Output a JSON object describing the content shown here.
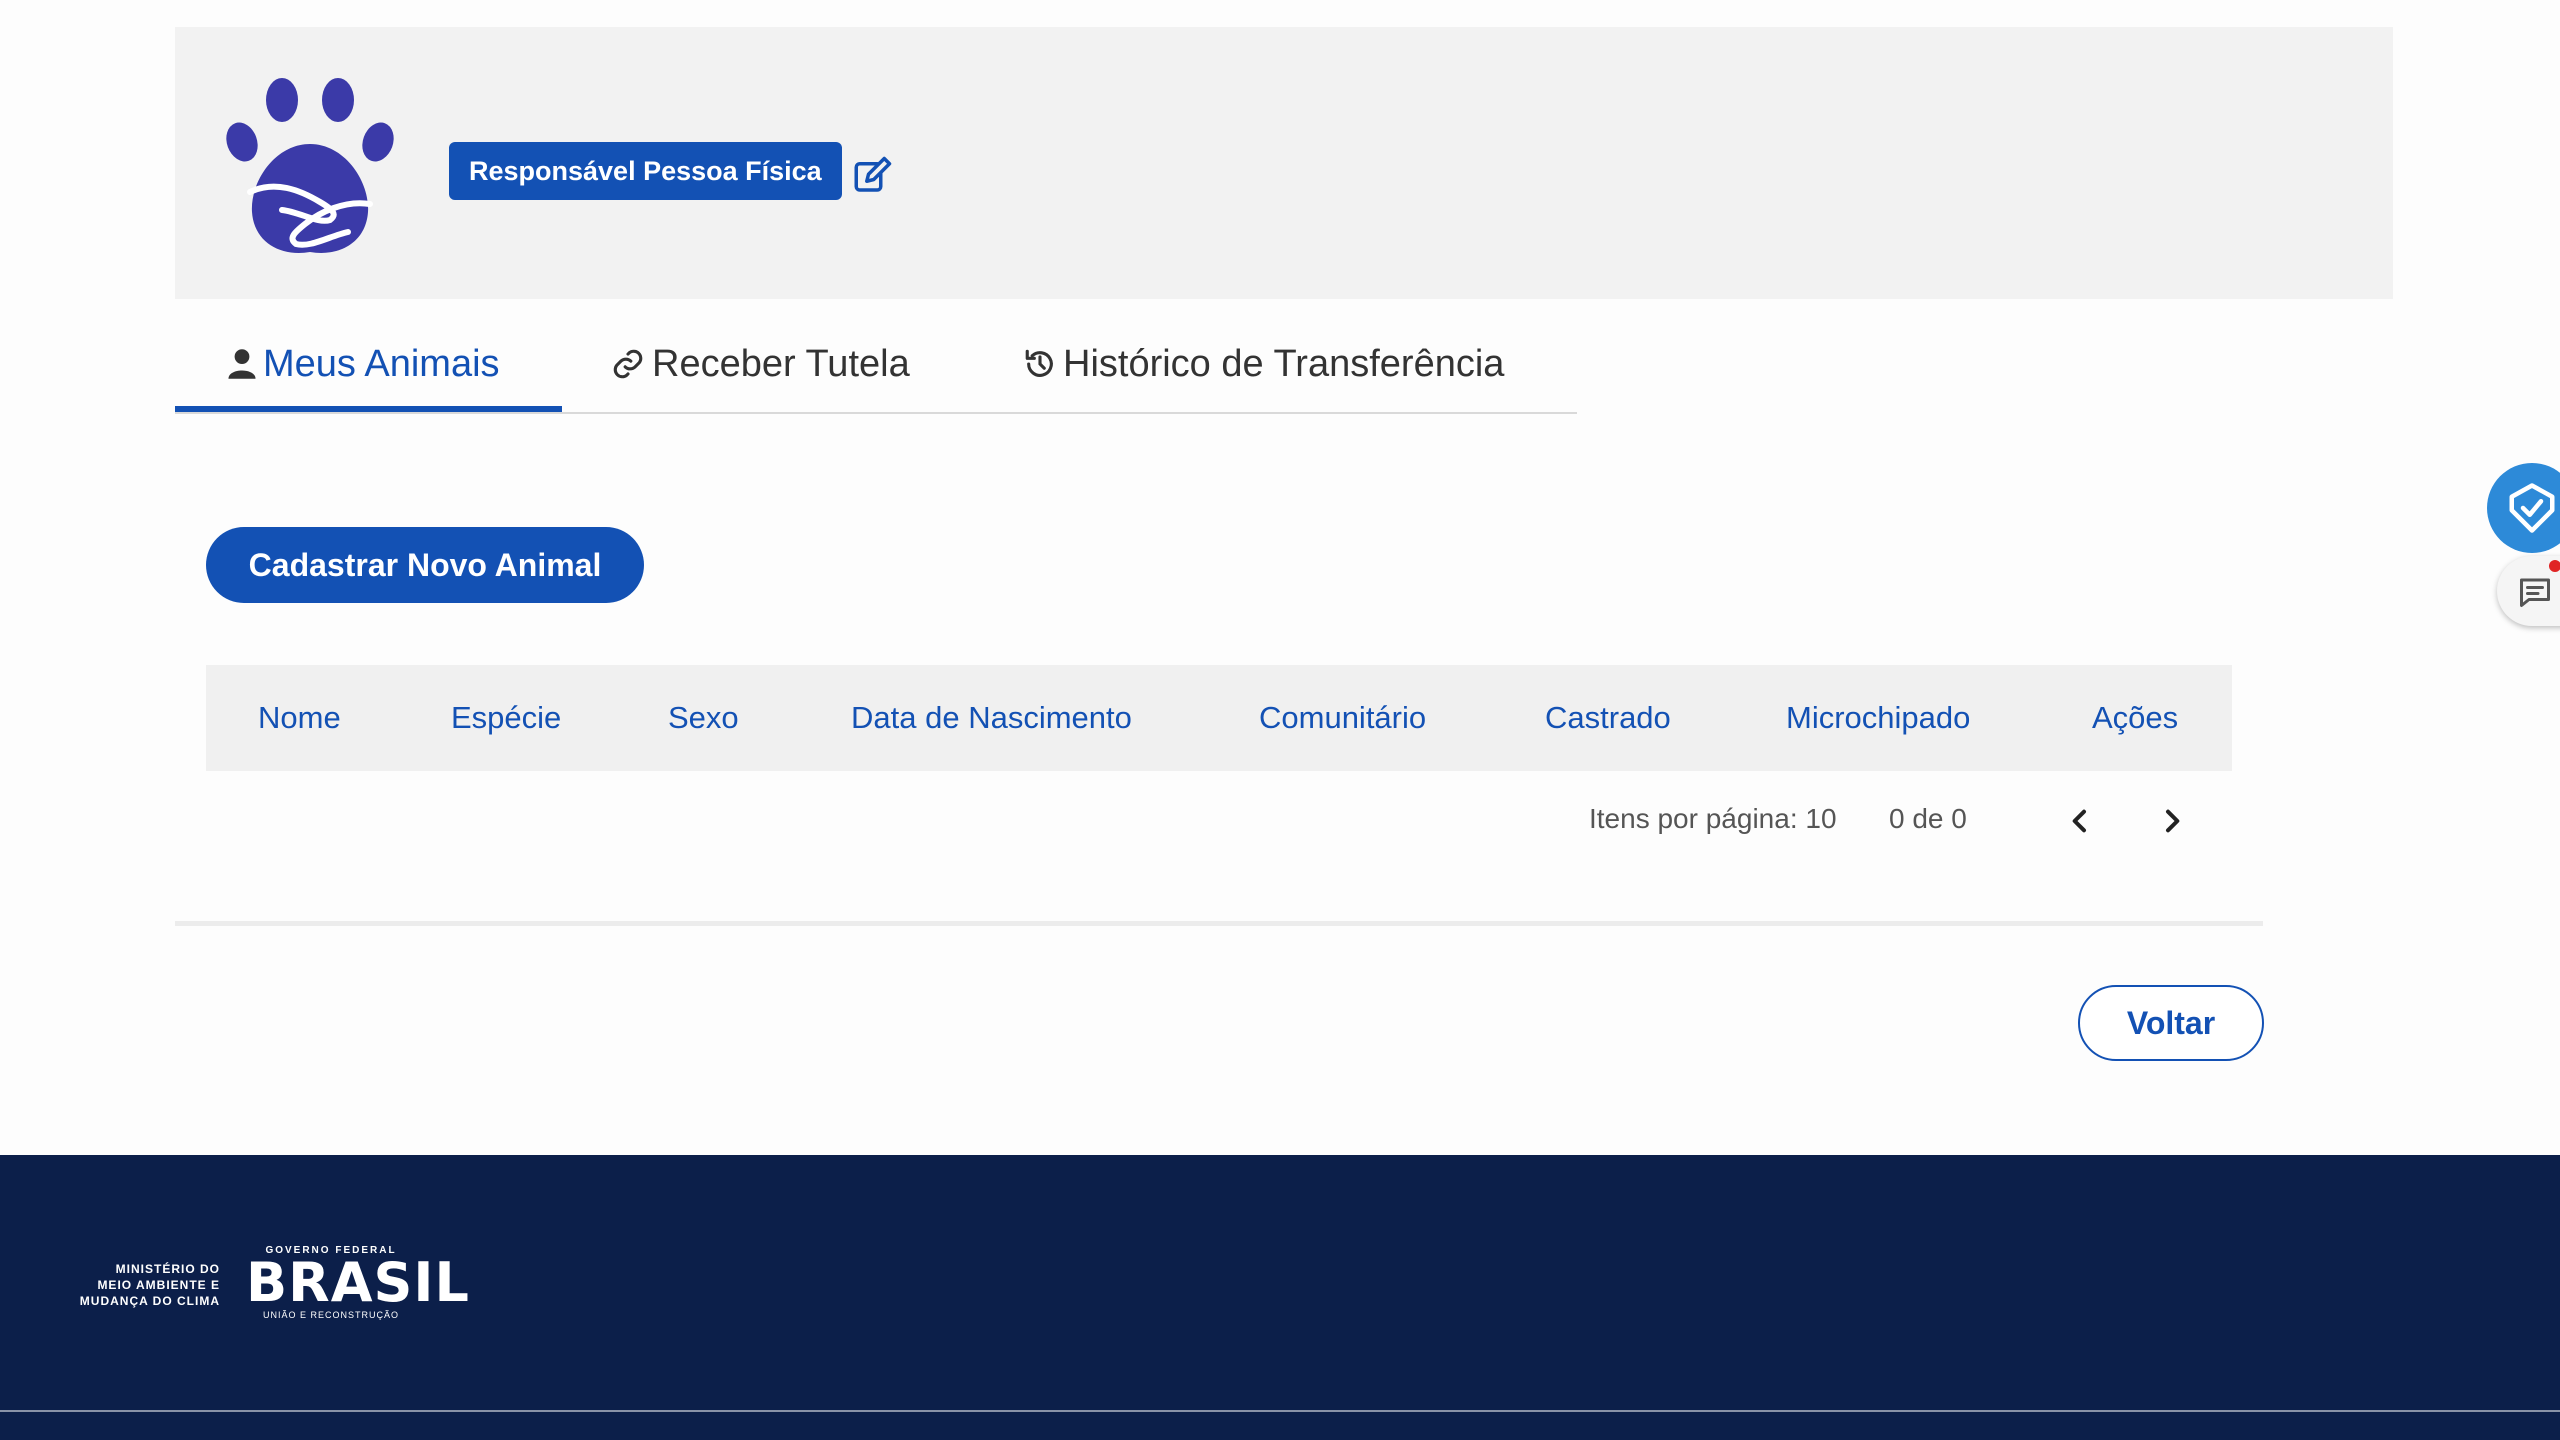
{
  "header": {
    "role_badge": "Responsável Pessoa Física",
    "brand_color": "#1351b4",
    "logo_icon": "paw-hug-icon",
    "edit_icon": "edit-icon"
  },
  "tabs": [
    {
      "label": "Meus Animais",
      "icon": "user-icon",
      "active": true
    },
    {
      "label": "Receber Tutela",
      "icon": "link-icon",
      "active": false
    },
    {
      "label": "Histórico de Transferência",
      "icon": "history-icon",
      "active": false
    }
  ],
  "actions": {
    "register_label": "Cadastrar Novo Animal",
    "back_label": "Voltar"
  },
  "table": {
    "columns": [
      "Nome",
      "Espécie",
      "Sexo",
      "Data de Nascimento",
      "Comunitário",
      "Castrado",
      "Microchipado",
      "Ações"
    ],
    "rows": []
  },
  "pagination": {
    "items_per_page": "Itens por página: 10",
    "range": "0 de 0"
  },
  "footer": {
    "ministry_lines": [
      "MINISTÉRIO DO",
      "MEIO AMBIENTE E",
      "MUDANÇA DO CLIMA"
    ],
    "gov_top": "GOVERNO FEDERAL",
    "gov_name": "BRASIL",
    "gov_sub": "UNIÃO E RECONSTRUÇÃO",
    "background": "#0c1f4a"
  }
}
